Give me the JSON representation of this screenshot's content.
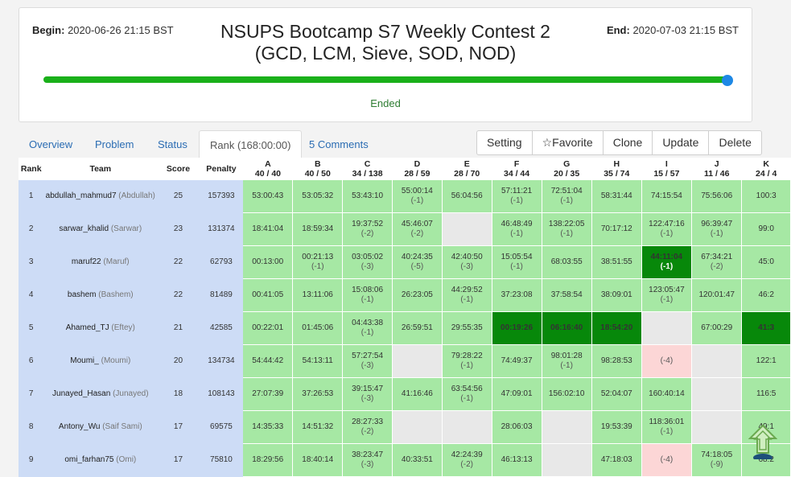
{
  "contest": {
    "begin_label": "Begin:",
    "begin_value": "2020-06-26 21:15 BST",
    "end_label": "End:",
    "end_value": "2020-07-03 21:15 BST",
    "title_line1": "NSUPS Bootcamp S7 Weekly Contest 2",
    "title_line2": "(GCD, LCM, Sieve, SOD, NOD)",
    "status": "Ended",
    "progress": 1.0,
    "colors": {
      "progress": "#1ab01a",
      "knob": "#1e88e5",
      "accepted": "#a6e8a4",
      "first_solve": "#07880a",
      "wrong": "#fcd6d6",
      "info_col": "#cddcf6"
    }
  },
  "tabs": [
    {
      "label": "Overview"
    },
    {
      "label": "Problem"
    },
    {
      "label": "Status"
    },
    {
      "label": "Rank (168:00:00)"
    },
    {
      "label": "5 Comments"
    }
  ],
  "buttons": {
    "setting": "Setting",
    "favorite": "☆Favorite",
    "clone": "Clone",
    "update": "Update",
    "delete": "Delete"
  },
  "table": {
    "headers": {
      "rank": "Rank",
      "team": "Team",
      "score": "Score",
      "penalty": "Penalty"
    },
    "problems": [
      {
        "letter": "A",
        "stat": "40 / 40"
      },
      {
        "letter": "B",
        "stat": "40 / 50"
      },
      {
        "letter": "C",
        "stat": "34 / 138"
      },
      {
        "letter": "D",
        "stat": "28 / 59"
      },
      {
        "letter": "E",
        "stat": "28 / 70"
      },
      {
        "letter": "F",
        "stat": "34 / 44"
      },
      {
        "letter": "G",
        "stat": "20 / 35"
      },
      {
        "letter": "H",
        "stat": "35 / 74"
      },
      {
        "letter": "I",
        "stat": "15 / 57"
      },
      {
        "letter": "J",
        "stat": "11 / 46"
      },
      {
        "letter": "K",
        "stat": "24 / 4"
      }
    ],
    "rows": [
      {
        "rank": "1",
        "handle": "abdullah_mahmud7",
        "nick": "(Abdullah)",
        "score": "25",
        "penalty": "157393",
        "cells": [
          {
            "s": "ac",
            "t": "53:00:43",
            "n": ""
          },
          {
            "s": "ac",
            "t": "53:05:32",
            "n": ""
          },
          {
            "s": "ac",
            "t": "53:43:10",
            "n": ""
          },
          {
            "s": "ac",
            "t": "55:00:14",
            "n": "(-1)"
          },
          {
            "s": "ac",
            "t": "56:04:56",
            "n": ""
          },
          {
            "s": "ac",
            "t": "57:11:21",
            "n": "(-1)"
          },
          {
            "s": "ac",
            "t": "72:51:04",
            "n": "(-1)"
          },
          {
            "s": "ac",
            "t": "58:31:44",
            "n": ""
          },
          {
            "s": "ac",
            "t": "74:15:54",
            "n": ""
          },
          {
            "s": "ac",
            "t": "75:56:06",
            "n": ""
          },
          {
            "s": "ac",
            "t": "100:3",
            "n": ""
          }
        ]
      },
      {
        "rank": "2",
        "handle": "sarwar_khalid",
        "nick": "(Sarwar)",
        "score": "23",
        "penalty": "131374",
        "cells": [
          {
            "s": "ac",
            "t": "18:41:04",
            "n": ""
          },
          {
            "s": "ac",
            "t": "18:59:34",
            "n": ""
          },
          {
            "s": "ac",
            "t": "19:37:52",
            "n": "(-2)"
          },
          {
            "s": "ac",
            "t": "45:46:07",
            "n": "(-2)"
          },
          {
            "s": "no",
            "t": "",
            "n": ""
          },
          {
            "s": "ac",
            "t": "46:48:49",
            "n": "(-1)"
          },
          {
            "s": "ac",
            "t": "138:22:05",
            "n": "(-1)"
          },
          {
            "s": "ac",
            "t": "70:17:12",
            "n": ""
          },
          {
            "s": "ac",
            "t": "122:47:16",
            "n": "(-1)"
          },
          {
            "s": "ac",
            "t": "96:39:47",
            "n": "(-1)"
          },
          {
            "s": "ac",
            "t": "99:0",
            "n": ""
          }
        ]
      },
      {
        "rank": "3",
        "handle": "maruf22",
        "nick": "(Maruf)",
        "score": "22",
        "penalty": "62793",
        "cells": [
          {
            "s": "ac",
            "t": "00:13:00",
            "n": ""
          },
          {
            "s": "ac",
            "t": "00:21:13",
            "n": "(-1)"
          },
          {
            "s": "ac",
            "t": "03:05:02",
            "n": "(-3)"
          },
          {
            "s": "ac",
            "t": "40:24:35",
            "n": "(-5)"
          },
          {
            "s": "ac",
            "t": "42:40:50",
            "n": "(-3)"
          },
          {
            "s": "ac",
            "t": "15:05:54",
            "n": "(-1)"
          },
          {
            "s": "ac",
            "t": "68:03:55",
            "n": ""
          },
          {
            "s": "ac",
            "t": "38:51:55",
            "n": ""
          },
          {
            "s": "first",
            "t": "44:11:04",
            "n": "(-1)"
          },
          {
            "s": "ac",
            "t": "67:34:21",
            "n": "(-2)"
          },
          {
            "s": "ac",
            "t": "45:0",
            "n": ""
          }
        ]
      },
      {
        "rank": "4",
        "handle": "bashem",
        "nick": "(Bashem)",
        "score": "22",
        "penalty": "81489",
        "cells": [
          {
            "s": "ac",
            "t": "00:41:05",
            "n": ""
          },
          {
            "s": "ac",
            "t": "13:11:06",
            "n": ""
          },
          {
            "s": "ac",
            "t": "15:08:06",
            "n": "(-1)"
          },
          {
            "s": "ac",
            "t": "26:23:05",
            "n": ""
          },
          {
            "s": "ac",
            "t": "44:29:52",
            "n": "(-1)"
          },
          {
            "s": "ac",
            "t": "37:23:08",
            "n": ""
          },
          {
            "s": "ac",
            "t": "37:58:54",
            "n": ""
          },
          {
            "s": "ac",
            "t": "38:09:01",
            "n": ""
          },
          {
            "s": "ac",
            "t": "123:05:47",
            "n": "(-1)"
          },
          {
            "s": "ac",
            "t": "120:01:47",
            "n": ""
          },
          {
            "s": "ac",
            "t": "46:2",
            "n": ""
          }
        ]
      },
      {
        "rank": "5",
        "handle": "Ahamed_TJ",
        "nick": "(Eftey)",
        "score": "21",
        "penalty": "42585",
        "cells": [
          {
            "s": "ac",
            "t": "00:22:01",
            "n": ""
          },
          {
            "s": "ac",
            "t": "01:45:06",
            "n": ""
          },
          {
            "s": "ac",
            "t": "04:43:38",
            "n": "(-1)"
          },
          {
            "s": "ac",
            "t": "26:59:51",
            "n": ""
          },
          {
            "s": "ac",
            "t": "29:55:35",
            "n": ""
          },
          {
            "s": "first",
            "t": "00:19:26",
            "n": ""
          },
          {
            "s": "first",
            "t": "06:16:40",
            "n": ""
          },
          {
            "s": "first",
            "t": "18:54:20",
            "n": ""
          },
          {
            "s": "no",
            "t": "",
            "n": ""
          },
          {
            "s": "ac",
            "t": "67:00:29",
            "n": ""
          },
          {
            "s": "first",
            "t": "41:3",
            "n": ""
          }
        ]
      },
      {
        "rank": "6",
        "handle": "Moumi_",
        "nick": "(Moumi)",
        "score": "20",
        "penalty": "134734",
        "cells": [
          {
            "s": "ac",
            "t": "54:44:42",
            "n": ""
          },
          {
            "s": "ac",
            "t": "54:13:11",
            "n": ""
          },
          {
            "s": "ac",
            "t": "57:27:54",
            "n": "(-3)"
          },
          {
            "s": "no",
            "t": "",
            "n": ""
          },
          {
            "s": "ac",
            "t": "79:28:22",
            "n": "(-1)"
          },
          {
            "s": "ac",
            "t": "74:49:37",
            "n": ""
          },
          {
            "s": "ac",
            "t": "98:01:28",
            "n": "(-1)"
          },
          {
            "s": "ac",
            "t": "98:28:53",
            "n": ""
          },
          {
            "s": "wa",
            "t": "",
            "n": "(-4)"
          },
          {
            "s": "no",
            "t": "",
            "n": ""
          },
          {
            "s": "ac",
            "t": "122:1",
            "n": ""
          }
        ]
      },
      {
        "rank": "7",
        "handle": "Junayed_Hasan",
        "nick": "(Junayed)",
        "score": "18",
        "penalty": "108143",
        "cells": [
          {
            "s": "ac",
            "t": "27:07:39",
            "n": ""
          },
          {
            "s": "ac",
            "t": "37:26:53",
            "n": ""
          },
          {
            "s": "ac",
            "t": "39:15:47",
            "n": "(-3)"
          },
          {
            "s": "ac",
            "t": "41:16:46",
            "n": ""
          },
          {
            "s": "ac",
            "t": "63:54:56",
            "n": "(-1)"
          },
          {
            "s": "ac",
            "t": "47:09:01",
            "n": ""
          },
          {
            "s": "ac",
            "t": "156:02:10",
            "n": ""
          },
          {
            "s": "ac",
            "t": "52:04:07",
            "n": ""
          },
          {
            "s": "ac",
            "t": "160:40:14",
            "n": ""
          },
          {
            "s": "no",
            "t": "",
            "n": ""
          },
          {
            "s": "ac",
            "t": "116:5",
            "n": ""
          }
        ]
      },
      {
        "rank": "8",
        "handle": "Antony_Wu",
        "nick": "(Saif Sami)",
        "score": "17",
        "penalty": "69575",
        "cells": [
          {
            "s": "ac",
            "t": "14:35:33",
            "n": ""
          },
          {
            "s": "ac",
            "t": "14:51:32",
            "n": ""
          },
          {
            "s": "ac",
            "t": "28:27:33",
            "n": "(-2)"
          },
          {
            "s": "no",
            "t": "",
            "n": ""
          },
          {
            "s": "no",
            "t": "",
            "n": ""
          },
          {
            "s": "ac",
            "t": "28:06:03",
            "n": ""
          },
          {
            "s": "no",
            "t": "",
            "n": ""
          },
          {
            "s": "ac",
            "t": "19:53:39",
            "n": ""
          },
          {
            "s": "ac",
            "t": "118:36:01",
            "n": "(-1)"
          },
          {
            "s": "no",
            "t": "",
            "n": ""
          },
          {
            "s": "ac",
            "t": "49:1",
            "n": ""
          }
        ]
      },
      {
        "rank": "9",
        "handle": "omi_farhan75",
        "nick": "(Omi)",
        "score": "17",
        "penalty": "75810",
        "cells": [
          {
            "s": "ac",
            "t": "18:29:56",
            "n": ""
          },
          {
            "s": "ac",
            "t": "18:40:14",
            "n": ""
          },
          {
            "s": "ac",
            "t": "38:23:47",
            "n": "(-3)"
          },
          {
            "s": "ac",
            "t": "40:33:51",
            "n": ""
          },
          {
            "s": "ac",
            "t": "42:24:39",
            "n": "(-2)"
          },
          {
            "s": "ac",
            "t": "46:13:13",
            "n": ""
          },
          {
            "s": "no",
            "t": "",
            "n": ""
          },
          {
            "s": "ac",
            "t": "47:18:03",
            "n": ""
          },
          {
            "s": "wa",
            "t": "",
            "n": "(-4)"
          },
          {
            "s": "ac",
            "t": "74:18:05",
            "n": "(-9)"
          },
          {
            "s": "ac",
            "t": "68:2",
            "n": ""
          }
        ]
      }
    ]
  },
  "scroll_top_icon": "up-arrow-icon"
}
